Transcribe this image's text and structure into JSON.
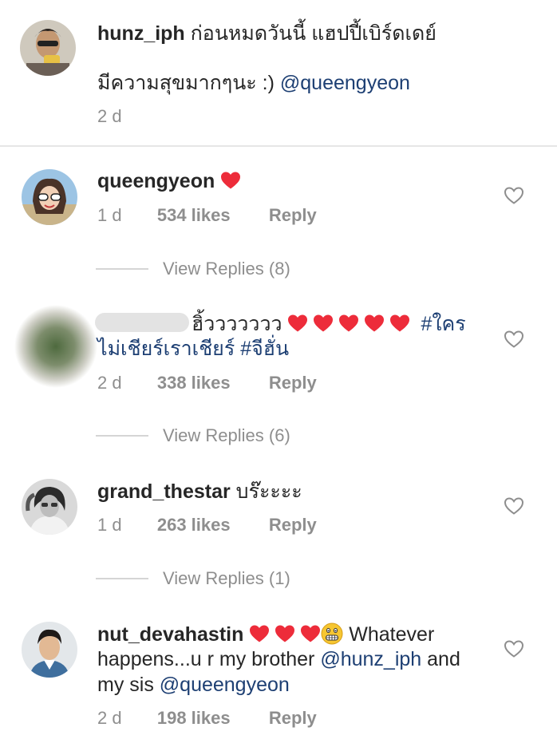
{
  "caption": {
    "username": "hunz_iph",
    "text_line1": "ก่อนหมดวันนี้ แฮปปี้เบิร์ดเดย์",
    "text_line2": "มีความสุขมากๆนะ :)",
    "mention": "@queengyeon",
    "time": "2 d"
  },
  "comments": [
    {
      "username": "queengyeon",
      "hearts": 1,
      "time": "1 d",
      "likes": "534 likes",
      "reply": "Reply",
      "view_replies": "View Replies (8)"
    },
    {
      "username": "",
      "text_line1": "ฮิ้ววววววว",
      "hearts": 5,
      "hashtag1": "#ใคร",
      "hashtag1_line2": "ไม่เชียร์เราเชียร์",
      "hashtag2": "#จีฮั่น",
      "time": "2 d",
      "likes": "338 likes",
      "reply": "Reply",
      "view_replies": "View Replies (6)"
    },
    {
      "username": "grand_thestar",
      "text": "บร๊ะะะะ",
      "time": "1 d",
      "likes": "263 likes",
      "reply": "Reply",
      "view_replies": "View Replies (1)"
    },
    {
      "username": "nut_devahastin",
      "hearts": 3,
      "emoji": "grimacing-face",
      "text_line1": "Whatever",
      "text_line2": "happens...u r my brother",
      "mention1": "@hunz_iph",
      "text_and": "and",
      "text_line3": "my sis",
      "mention2": "@queengyeon",
      "time": "2 d",
      "likes": "198 likes",
      "reply": "Reply"
    }
  ],
  "colors": {
    "text": "#262626",
    "meta": "#8e8e8e",
    "mention": "#1d3f73",
    "heart": "#ed2c3a"
  }
}
